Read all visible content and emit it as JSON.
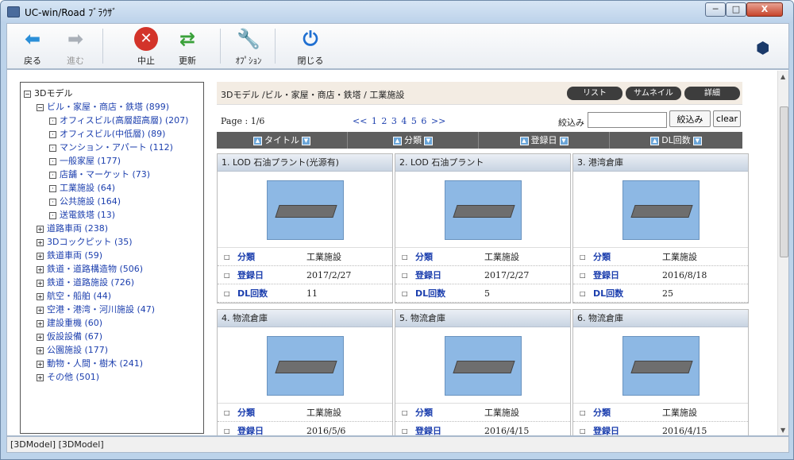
{
  "app": {
    "title": "UC-win/Road ﾌﾞﾗｳｻﾞ",
    "min": "─",
    "max": "□",
    "close": "X"
  },
  "toolbar": {
    "back": "戻る",
    "forward": "進む",
    "stop": "中止",
    "refresh": "更新",
    "options": "ｵﾌﾟｼｮﾝ",
    "close": "閉じる"
  },
  "tree": {
    "items": [
      {
        "sign": "−",
        "label": "3Dモデル",
        "link": false,
        "indent": 0
      },
      {
        "sign": "−",
        "label": "ビル・家屋・商店・鉄塔 (899)",
        "link": true,
        "indent": 1
      },
      {
        "sign": "·",
        "label": "オフィスビル(高層超高層) (207)",
        "link": true,
        "indent": 2
      },
      {
        "sign": "·",
        "label": "オフィスビル(中低層) (89)",
        "link": true,
        "indent": 2
      },
      {
        "sign": "·",
        "label": "マンション・アパート (112)",
        "link": true,
        "indent": 2
      },
      {
        "sign": "·",
        "label": "一般家屋 (177)",
        "link": true,
        "indent": 2
      },
      {
        "sign": "·",
        "label": "店舗・マーケット (73)",
        "link": true,
        "indent": 2
      },
      {
        "sign": "·",
        "label": "工業施設 (64)",
        "link": true,
        "indent": 2
      },
      {
        "sign": "·",
        "label": "公共施設 (164)",
        "link": true,
        "indent": 2
      },
      {
        "sign": "·",
        "label": "送電鉄塔 (13)",
        "link": true,
        "indent": 2
      },
      {
        "sign": "+",
        "label": "道路車両 (238)",
        "link": true,
        "indent": 1
      },
      {
        "sign": "+",
        "label": "3Dコックピット (35)",
        "link": true,
        "indent": 1
      },
      {
        "sign": "+",
        "label": "鉄道車両 (59)",
        "link": true,
        "indent": 1
      },
      {
        "sign": "+",
        "label": "鉄道・道路構造物 (506)",
        "link": true,
        "indent": 1
      },
      {
        "sign": "+",
        "label": "鉄道・道路施設 (726)",
        "link": true,
        "indent": 1
      },
      {
        "sign": "+",
        "label": "航空・船舶 (44)",
        "link": true,
        "indent": 1
      },
      {
        "sign": "+",
        "label": "空港・港湾・河川施設 (47)",
        "link": true,
        "indent": 1
      },
      {
        "sign": "+",
        "label": "建設重機 (60)",
        "link": true,
        "indent": 1
      },
      {
        "sign": "+",
        "label": "仮設設備 (67)",
        "link": true,
        "indent": 1
      },
      {
        "sign": "+",
        "label": "公園施設 (177)",
        "link": true,
        "indent": 1
      },
      {
        "sign": "+",
        "label": "動物・人間・樹木 (241)",
        "link": true,
        "indent": 1
      },
      {
        "sign": "+",
        "label": "その他 (501)",
        "link": true,
        "indent": 1
      }
    ]
  },
  "breadcrumb": "3Dモデル /ビル・家屋・商店・鉄塔 / 工業施設",
  "views": {
    "list": "リスト",
    "thumb": "サムネイル",
    "detail": "詳細"
  },
  "page_label": "Page : 1/6",
  "pager": "<<  1  2  3  4  5  6  >>",
  "filter": {
    "label": "絞込み",
    "value": "",
    "button": "絞込み",
    "clear": "clear"
  },
  "sort": {
    "title": "タイトル",
    "category": "分類",
    "date": "登録日",
    "dl": "DL回数"
  },
  "fields": {
    "category": "分類",
    "date": "登録日",
    "dl": "DL回数"
  },
  "cards": [
    {
      "title": "1. LOD 石油プラント(光源有)",
      "category": "工業施設",
      "date": "2017/2/27",
      "dl": "11"
    },
    {
      "title": "2. LOD 石油プラント",
      "category": "工業施設",
      "date": "2017/2/27",
      "dl": "5"
    },
    {
      "title": "3. 港湾倉庫",
      "category": "工業施設",
      "date": "2016/8/18",
      "dl": "25"
    },
    {
      "title": "4. 物流倉庫",
      "category": "工業施設",
      "date": "2016/5/6",
      "dl": ""
    },
    {
      "title": "5. 物流倉庫",
      "category": "工業施設",
      "date": "2016/4/15",
      "dl": ""
    },
    {
      "title": "6. 物流倉庫",
      "category": "工業施設",
      "date": "2016/4/15",
      "dl": ""
    }
  ],
  "status": "[3DModel] [3DModel]"
}
